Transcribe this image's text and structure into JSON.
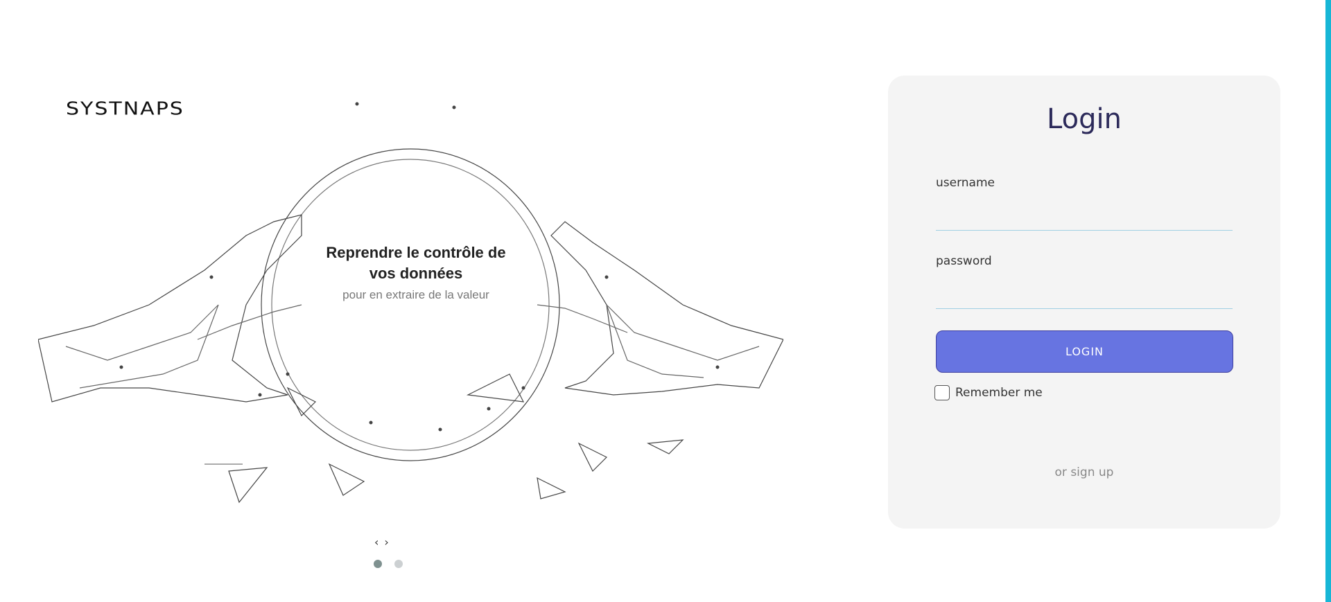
{
  "brand": {
    "logo_text": "SYSTNAPS"
  },
  "hero": {
    "title": "Reprendre le contrôle de vos données",
    "subtitle": "pour en extraire de la valeur",
    "prev_icon": "chevron-left-icon",
    "next_icon": "chevron-right-icon",
    "prev_glyph": "‹",
    "next_glyph": "›",
    "slide_count": 2,
    "active_slide": 1
  },
  "login": {
    "title": "Login",
    "username_label": "username",
    "username_value": "",
    "password_label": "password",
    "password_value": "",
    "button_label": "LOGIN",
    "remember_label": "Remember me",
    "remember_checked": false,
    "signup_link": "or sign up"
  },
  "colors": {
    "accent": "#6774e1",
    "title": "#2c2a5a",
    "card_bg": "#f4f4f4",
    "edge_bar": "#17b6d6"
  }
}
